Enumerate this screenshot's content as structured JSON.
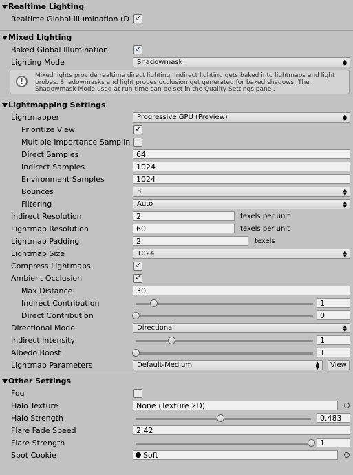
{
  "realtime": {
    "title": "Realtime Lighting",
    "rt_gi_label": "Realtime Global Illumination (D",
    "rt_gi_checked": true
  },
  "mixed": {
    "title": "Mixed Lighting",
    "baked_gi_label": "Baked Global Illumination",
    "baked_gi_checked": true,
    "lighting_mode_label": "Lighting Mode",
    "lighting_mode_value": "Shadowmask",
    "help_text": "Mixed lights provide realtime direct lighting. Indirect lighting gets baked into lightmaps and light probes. Shadowmasks and light probes occlusion get generated for baked shadows. The Shadowmask Mode used at run time can be set in the Quality Settings panel.",
    "help_icon": "info-icon"
  },
  "lightmapping": {
    "title": "Lightmapping Settings",
    "lightmapper_label": "Lightmapper",
    "lightmapper_value": "Progressive GPU (Preview)",
    "prioritize_view_label": "Prioritize View",
    "prioritize_view_checked": true,
    "mis_label": "Multiple Importance Samplin",
    "mis_checked": false,
    "direct_samples_label": "Direct Samples",
    "direct_samples_value": "64",
    "indirect_samples_label": "Indirect Samples",
    "indirect_samples_value": "1024",
    "env_samples_label": "Environment Samples",
    "env_samples_value": "1024",
    "bounces_label": "Bounces",
    "bounces_value": "3",
    "filtering_label": "Filtering",
    "filtering_value": "Auto",
    "indirect_res_label": "Indirect Resolution",
    "indirect_res_value": "2",
    "texels_per_unit": "texels per unit",
    "lightmap_res_label": "Lightmap Resolution",
    "lightmap_res_value": "60",
    "lightmap_padding_label": "Lightmap Padding",
    "lightmap_padding_value": "2",
    "texels": "texels",
    "lightmap_size_label": "Lightmap Size",
    "lightmap_size_value": "1024",
    "compress_label": "Compress Lightmaps",
    "compress_checked": true,
    "ao_label": "Ambient Occlusion",
    "ao_checked": true,
    "max_distance_label": "Max Distance",
    "max_distance_value": "30",
    "indirect_contrib_label": "Indirect Contribution",
    "indirect_contrib_value": "1",
    "indirect_contrib_slider": 0.1,
    "direct_contrib_label": "Direct Contribution",
    "direct_contrib_value": "0",
    "direct_contrib_slider": 0.0,
    "directional_mode_label": "Directional Mode",
    "directional_mode_value": "Directional",
    "indirect_intensity_label": "Indirect Intensity",
    "indirect_intensity_value": "1",
    "indirect_intensity_slider": 0.2,
    "albedo_boost_label": "Albedo Boost",
    "albedo_boost_value": "1",
    "albedo_boost_slider": 0.0,
    "lightmap_params_label": "Lightmap Parameters",
    "lightmap_params_value": "Default-Medium",
    "view_label": "View"
  },
  "other": {
    "title": "Other Settings",
    "fog_label": "Fog",
    "fog_checked": false,
    "halo_texture_label": "Halo Texture",
    "halo_texture_value": "None (Texture 2D)",
    "halo_strength_label": "Halo Strength",
    "halo_strength_value": "0.483",
    "halo_strength_slider": 0.483,
    "flare_fade_label": "Flare Fade Speed",
    "flare_fade_value": "2.42",
    "flare_strength_label": "Flare Strength",
    "flare_strength_value": "1",
    "flare_strength_slider": 1.0,
    "spot_cookie_label": "Spot Cookie",
    "spot_cookie_value": "Soft"
  }
}
